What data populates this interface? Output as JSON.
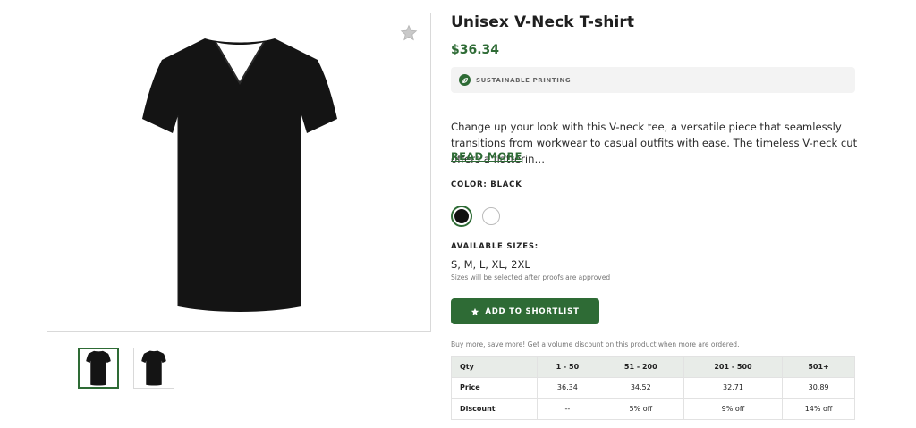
{
  "product": {
    "title": "Unisex V-Neck T-shirt",
    "price": "$36.34",
    "badge": "SUSTAINABLE PRINTING",
    "description": "Change up your look with this V-neck tee, a versatile piece that seamlessly transitions from workwear to casual outfits with ease. The timeless V-neck cut offers a flatterin…",
    "read_more": "READ MORE",
    "color_label": "COLOR: BLACK",
    "colors": [
      "black",
      "white"
    ],
    "selected_color": "black",
    "sizes_label": "AVAILABLE SIZES:",
    "sizes": "S, M, L, XL, 2XL",
    "sizes_note": "Sizes will be selected after proofs are approved",
    "shortlist_label": "ADD TO SHORTLIST",
    "volume_note": "Buy more, save more! Get a volume discount on this product when more are ordered."
  },
  "gallery": {
    "thumbnails": [
      "front",
      "back"
    ],
    "active_thumbnail": "front"
  },
  "pricing_table": {
    "headers": [
      "Qty",
      "1 - 50",
      "51 - 200",
      "201 - 500",
      "501+"
    ],
    "rows": [
      [
        "Price",
        "36.34",
        "34.52",
        "32.71",
        "30.89"
      ],
      [
        "Discount",
        "--",
        "5% off",
        "9% off",
        "14% off"
      ]
    ]
  },
  "colors": {
    "accent": "#2e6b35",
    "shirt": "#111111"
  },
  "icons": {
    "favorite": "star-icon",
    "badge": "leaf-icon",
    "shortlist": "star-icon"
  }
}
